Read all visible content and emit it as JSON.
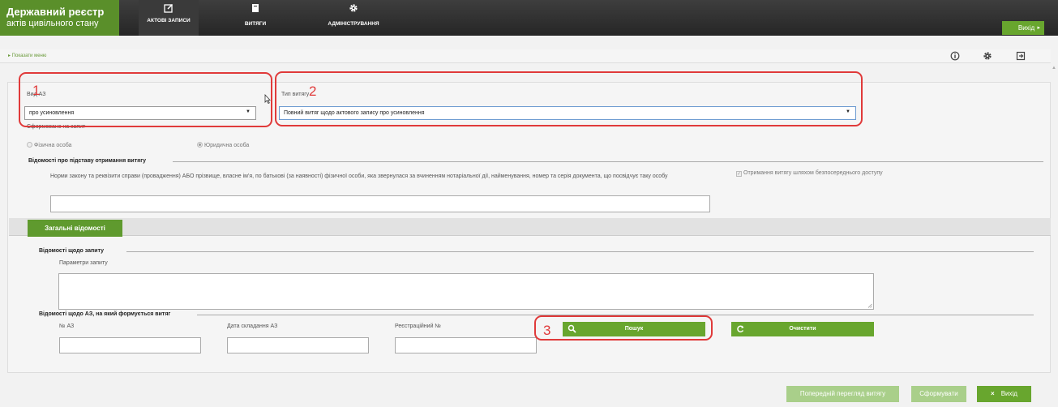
{
  "header": {
    "brand_line1": "Державний реєстр",
    "brand_line2": "актів цивільного стану",
    "tabs": [
      {
        "label": "АКТОВІ ЗАПИСИ",
        "icon": "edit-icon"
      },
      {
        "label": "ВИТЯГИ",
        "icon": "document-icon"
      },
      {
        "label": "АДМІНІСТРУВАННЯ",
        "icon": "gear-icon"
      }
    ],
    "exit_label": "Вихід",
    "exit_arrow": "▸"
  },
  "subbar": {
    "show_menu": "▸ Показати меню"
  },
  "form": {
    "az_type_label": "Вид АЗ",
    "az_type_value": "про усиновлення",
    "extract_type_label": "Тип витягу",
    "extract_type_value": "Повний витяг щодо актового запису про усиновлення",
    "formed_on_request": "Сформовано на запит",
    "radio_individual": "Фізична особа",
    "radio_legal": "Юридична особа",
    "basis_section": "Відомості про підставу отримання витягу",
    "basis_help": "Норми закону та реквізити справи (провадження) АБО прізвище, власне ім'я, по батькові (за наявності) фізичної особи, яка звернулася за вчиненням нотаріальної дії, найменування, номер та серія документа, що посвідчує таку особу",
    "direct_access": "Отримання витягу шляхом безпосереднього доступу",
    "general_tab": "Загальні відомості",
    "request_section": "Відомості щодо запиту",
    "request_params": "Параметри запиту",
    "az_section": "Відомості щодо АЗ, на який формується витяг",
    "az_number": "№ АЗ",
    "az_date": "Дата складання АЗ",
    "reg_number": "Реєстраційний №",
    "search_button": "Пошук",
    "clear_button": "Очистити"
  },
  "annotations": [
    "1",
    "2",
    "3"
  ],
  "footer": {
    "preview_button": "Попередній перегляд витягу",
    "form_button": "Сформувати",
    "exit_button": "Вихід",
    "exit_icon": "×"
  },
  "colors": {
    "brand_green": "#5a8f2a",
    "button_green": "#68a62e",
    "annotation_red": "#e03a3a",
    "topbar_dark": "#2e2e2e"
  }
}
